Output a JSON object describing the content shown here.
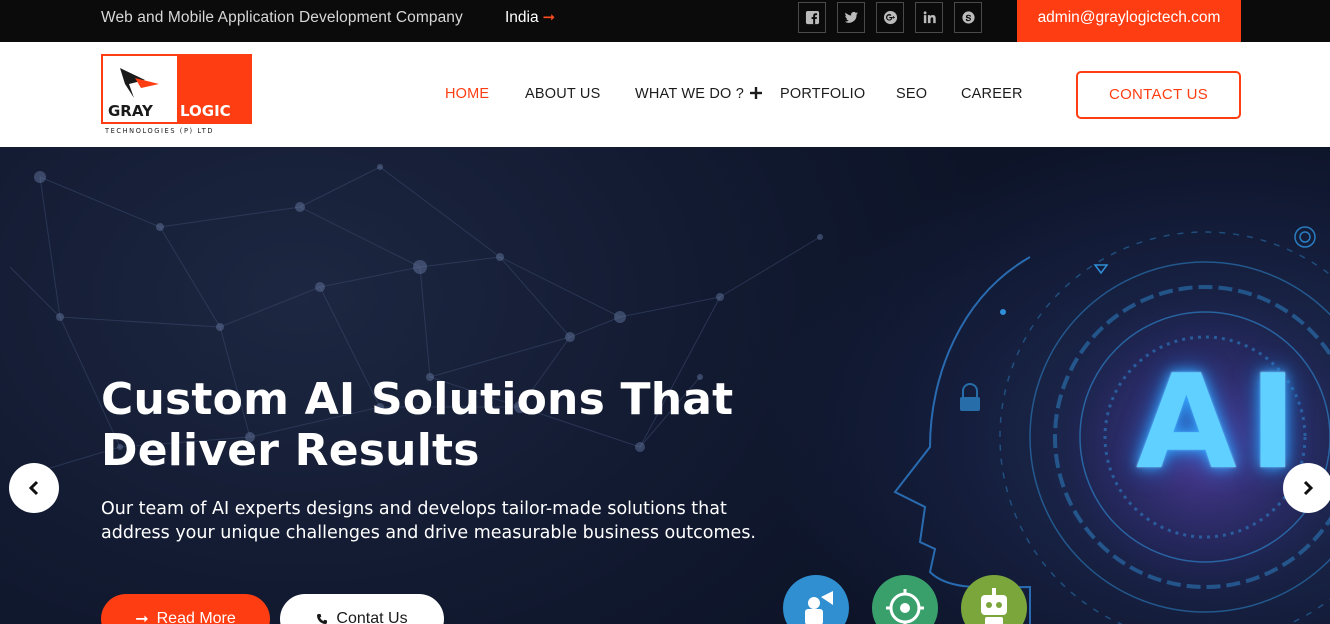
{
  "topbar": {
    "tagline": "Web and Mobile Application Development Company",
    "country": "India",
    "social_icons": [
      "facebook-icon",
      "twitter-icon",
      "google-plus-icon",
      "linkedin-icon",
      "skype-icon"
    ],
    "email": "admin@graylogictech.com"
  },
  "header": {
    "logo_word_1": "GRAY",
    "logo_word_2": "LOGIC",
    "logo_subtitle": "TECHNOLOGIES (P) LTD",
    "nav": {
      "home": "HOME",
      "about": "ABOUT US",
      "what": "WHAT WE DO ?",
      "portfolio": "PORTFOLIO",
      "seo": "SEO",
      "career": "CAREER"
    },
    "contact_label": "CONTACT US"
  },
  "hero": {
    "title": "Custom AI Solutions That Deliver Results",
    "description": "Our team of AI experts designs and develops tailor-made solutions that address your unique challenges and drive measurable business outcomes.",
    "read_more": "Read More",
    "contact": "Contat Us",
    "ai_label": "AI"
  },
  "colors": {
    "accent": "#ff3d12",
    "topbar_bg": "#0b0b0b",
    "hero_bg": "#0f1730"
  }
}
